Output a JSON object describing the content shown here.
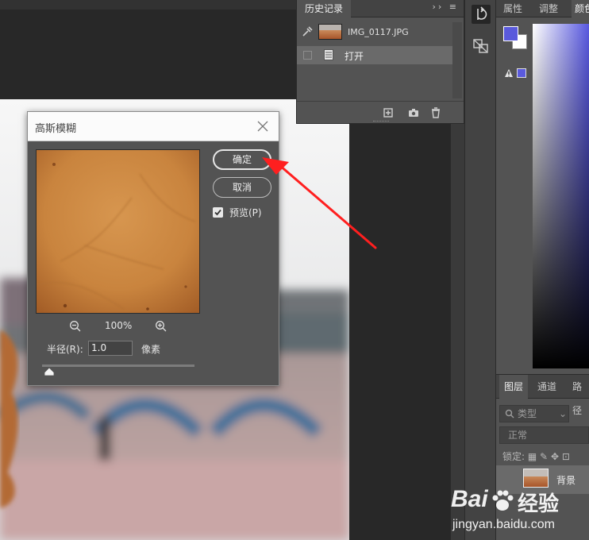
{
  "dialog": {
    "title": "高斯模糊",
    "ok_label": "确定",
    "cancel_label": "取消",
    "preview_label": "预览(P)",
    "preview_checked": true,
    "zoom_level": "100%",
    "radius_label": "半径(R):",
    "radius_value": "1.0",
    "radius_unit": "像素"
  },
  "history": {
    "tab_label": "历史记录",
    "snapshot_name": "IMG_0117.JPG",
    "state_label": "打开"
  },
  "right_panel": {
    "tabs": [
      "属性",
      "调整",
      "颜色"
    ],
    "fg_color": "#5a5adc",
    "bg_color": "#ffffff"
  },
  "layers": {
    "tabs": [
      "图层",
      "通道",
      "路径"
    ],
    "kind_filter": "类型",
    "blend_mode": "正常",
    "lock_label": "锁定:",
    "layer_name": "背景"
  },
  "watermark": {
    "brand_left": "Bai",
    "brand_right": "经验",
    "url": "jingyan.baidu.com"
  },
  "annotation_color": "#ff1f1f"
}
